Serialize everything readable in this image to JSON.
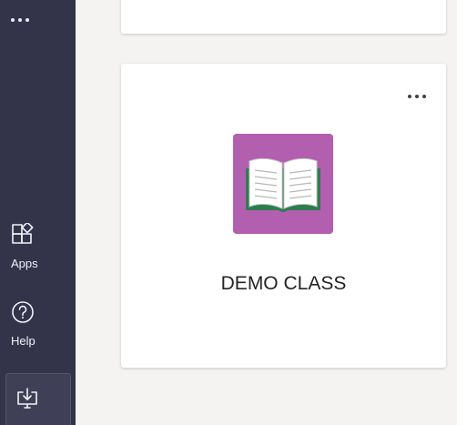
{
  "rail": {
    "more_icon": "more-horizontal-icon",
    "apps": {
      "label": "Apps",
      "icon": "apps-icon"
    },
    "help": {
      "label": "Help",
      "icon": "help-icon"
    },
    "download": {
      "icon": "download-app-icon"
    }
  },
  "class_card": {
    "name": "DEMO CLASS",
    "more_icon": "more-options-icon",
    "tile_icon": "open-book-icon",
    "tile_color": "#b25fb0"
  },
  "colors": {
    "rail_bg": "#33344a",
    "main_bg": "#f4f3f1",
    "book_green": "#2e7d4f"
  }
}
